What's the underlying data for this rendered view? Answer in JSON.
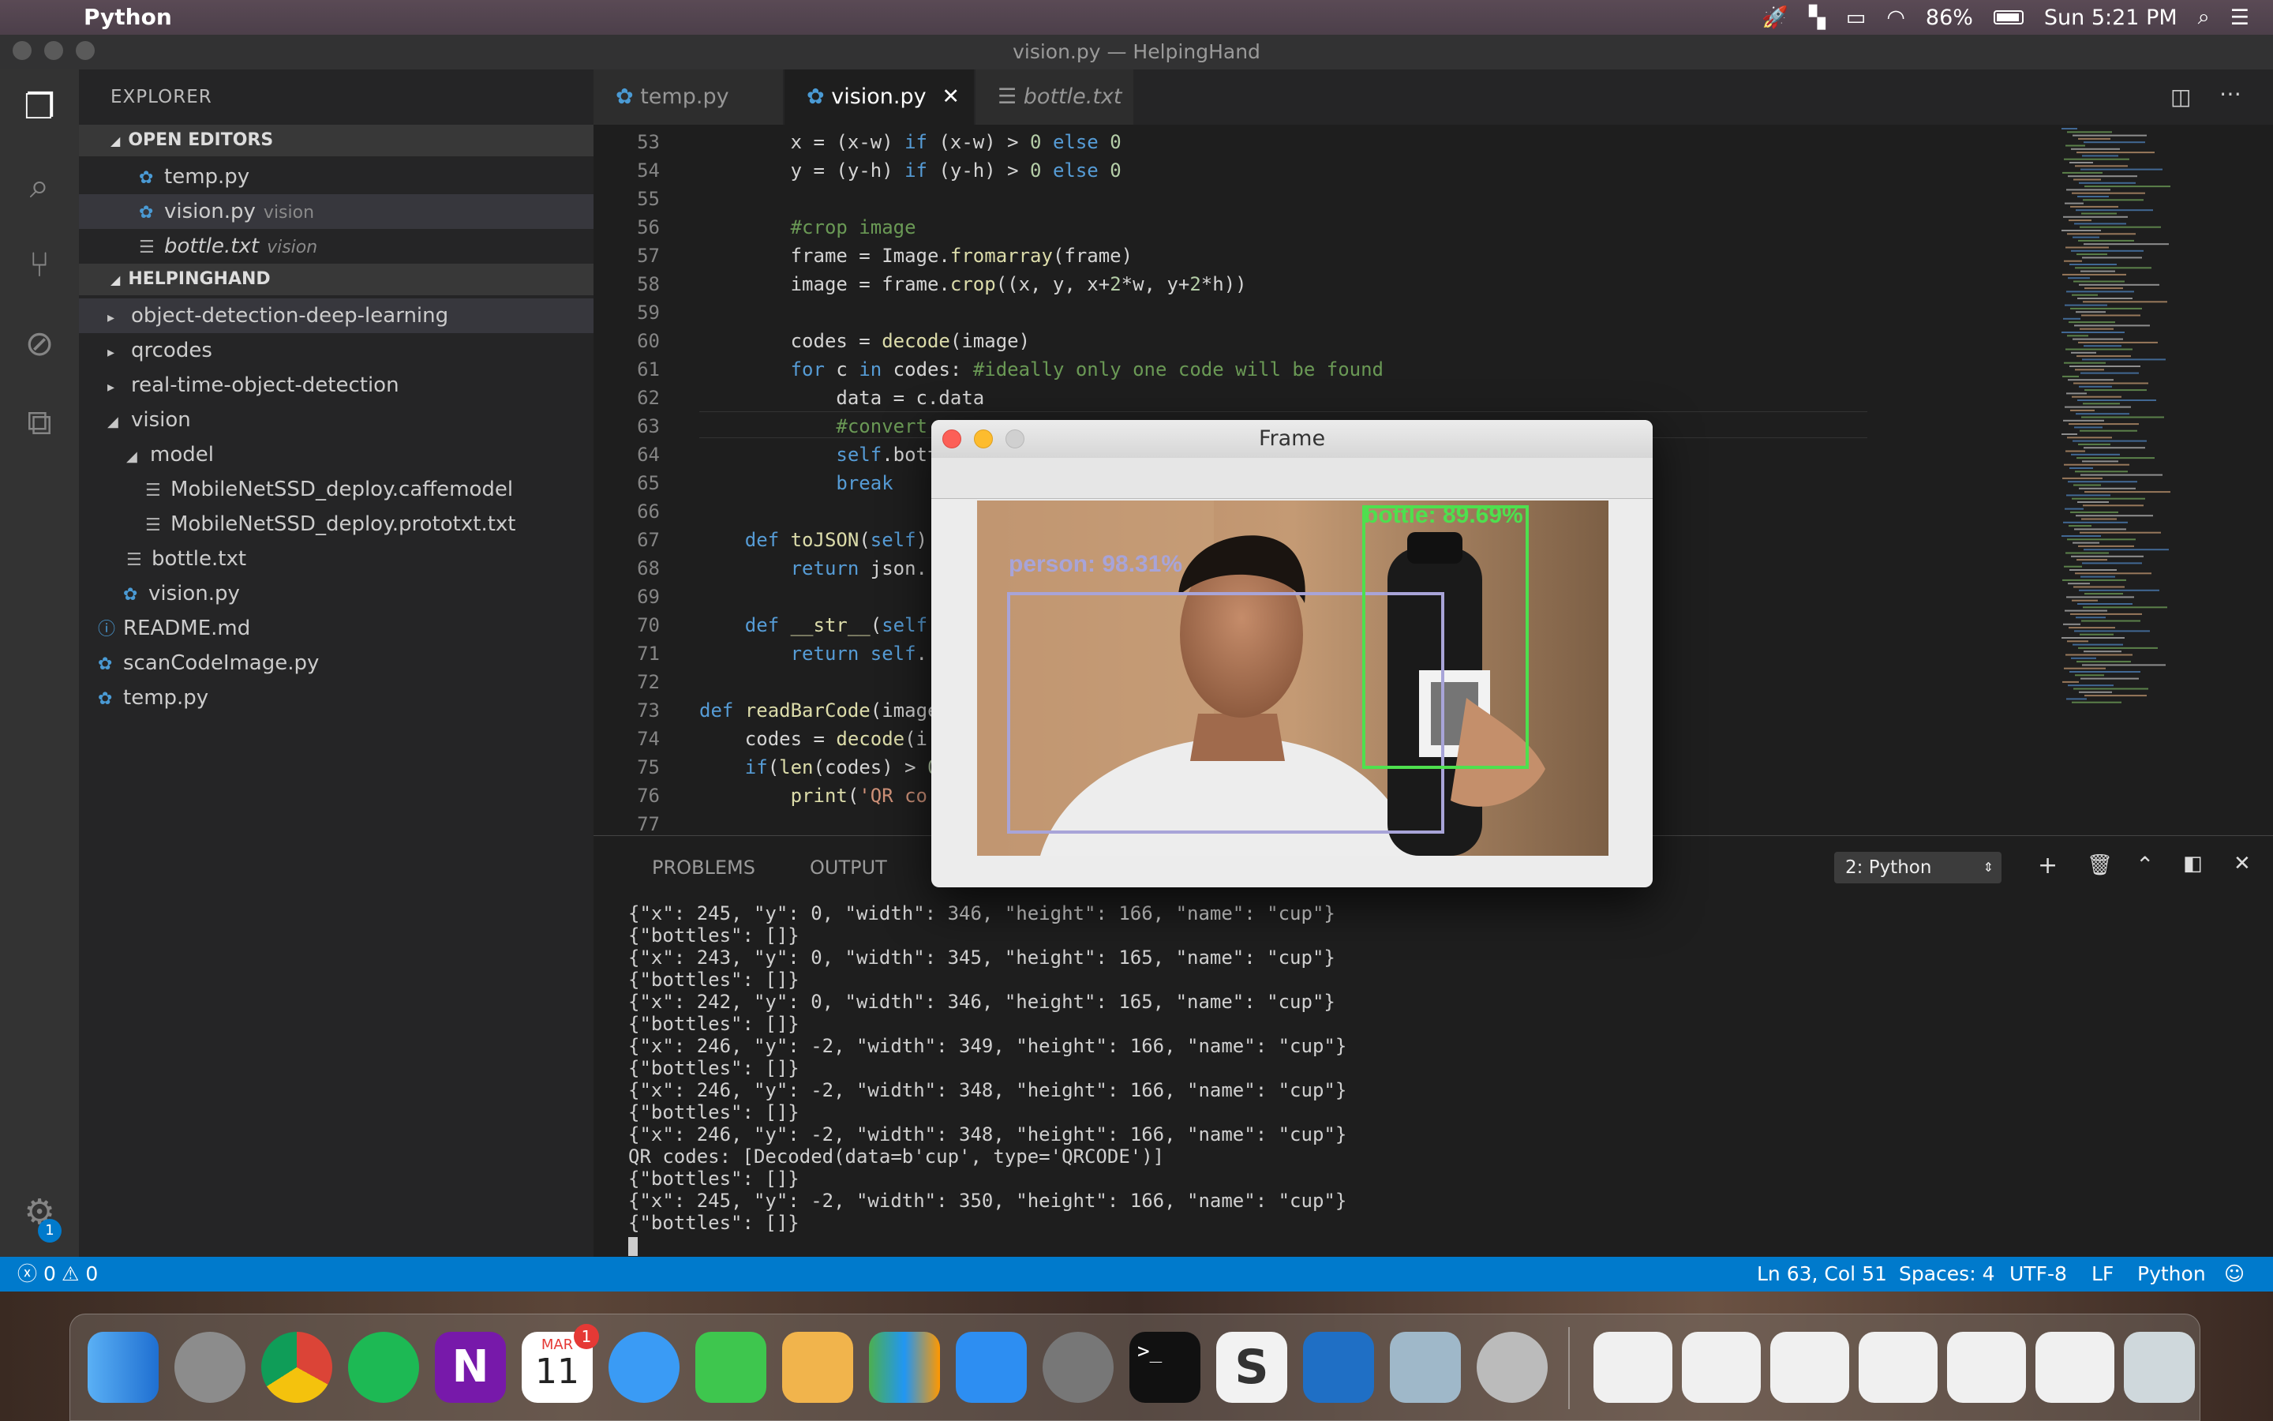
{
  "menubar": {
    "app": "Python",
    "clock": "Sun 5:21 PM",
    "battery": "86%"
  },
  "window": {
    "title": "vision.py — HelpingHand"
  },
  "explorer": {
    "title": "EXPLORER",
    "open_editors": "OPEN EDITORS",
    "project": "HELPINGHAND",
    "open": [
      {
        "name": "temp.py",
        "hint": ""
      },
      {
        "name": "vision.py",
        "hint": "vision"
      },
      {
        "name": "bottle.txt",
        "hint": "vision"
      }
    ],
    "tree": [
      "object-detection-deep-learning",
      "qrcodes",
      "real-time-object-detection",
      "vision",
      "model",
      "MobileNetSSD_deploy.caffemodel",
      "MobileNetSSD_deploy.prototxt.txt",
      "bottle.txt",
      "vision.py",
      "README.md",
      "scanCodeImage.py",
      "temp.py"
    ]
  },
  "tabs": [
    "temp.py",
    "vision.py",
    "bottle.txt"
  ],
  "code": {
    "lines": [
      "53",
      "54",
      "55",
      "56",
      "57",
      "58",
      "59",
      "60",
      "61",
      "62",
      "63",
      "64",
      "65",
      "66",
      "67",
      "68",
      "69",
      "70",
      "71",
      "72",
      "73",
      "74",
      "75",
      "76",
      "77"
    ]
  },
  "frame": {
    "title": "Frame",
    "label_person": "person: 98.31%",
    "label_bottle": "bottle: 89.69%"
  },
  "panel": {
    "problems": "PROBLEMS",
    "output": "OUTPUT",
    "terminal_select": "2: Python",
    "terminal": [
      "{\"x\": 245, \"y\": 0, \"width\": 346, \"height\": 166, \"name\": \"cup\"}",
      "{\"bottles\": []}",
      "{\"x\": 243, \"y\": 0, \"width\": 345, \"height\": 165, \"name\": \"cup\"}",
      "{\"bottles\": []}",
      "{\"x\": 242, \"y\": 0, \"width\": 346, \"height\": 165, \"name\": \"cup\"}",
      "{\"bottles\": []}",
      "{\"x\": 246, \"y\": -2, \"width\": 349, \"height\": 166, \"name\": \"cup\"}",
      "{\"bottles\": []}",
      "{\"x\": 246, \"y\": -2, \"width\": 348, \"height\": 166, \"name\": \"cup\"}",
      "{\"bottles\": []}",
      "{\"x\": 246, \"y\": -2, \"width\": 348, \"height\": 166, \"name\": \"cup\"}",
      "QR codes: [Decoded(data=b'cup', type='QRCODE')]",
      "{\"bottles\": []}",
      "{\"x\": 245, \"y\": -2, \"width\": 350, \"height\": 166, \"name\": \"cup\"}",
      "{\"bottles\": []}"
    ]
  },
  "status": {
    "errors": "0",
    "warnings": "0",
    "position": "Ln 63, Col 51",
    "spaces": "Spaces: 4",
    "encoding": "UTF-8",
    "eol": "LF",
    "language": "Python",
    "badge": "1"
  },
  "dock": {
    "calendar_month": "MAR",
    "calendar_day": "11",
    "calendar_badge": "1"
  }
}
